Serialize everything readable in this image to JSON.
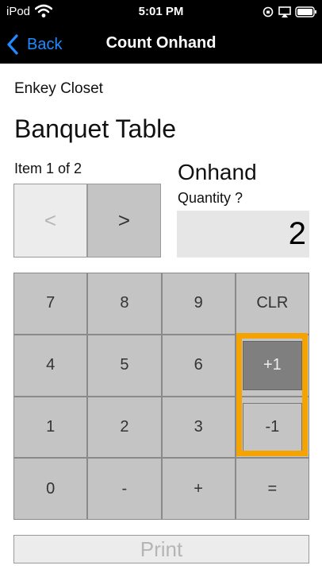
{
  "status_bar": {
    "carrier": "iPod",
    "time": "5:01 PM",
    "icons": [
      "wifi-icon",
      "orientation-lock-icon",
      "airplay-icon",
      "battery-icon"
    ]
  },
  "nav_bar": {
    "back_label": "Back",
    "title": "Count Onhand",
    "accent_color": "#1f8bff"
  },
  "item": {
    "location": "Enkey Closet",
    "name": "Banquet Table",
    "counter": "Item 1 of 2"
  },
  "quantity": {
    "heading": "Onhand",
    "label": "Quantity ?",
    "value": "2"
  },
  "item_nav": {
    "prev_label": "<",
    "next_label": ">"
  },
  "keypad": {
    "rows": [
      [
        "7",
        "8",
        "9",
        "CLR"
      ],
      [
        "4",
        "5",
        "6",
        "+1"
      ],
      [
        "1",
        "2",
        "3",
        "-1"
      ],
      [
        "0",
        "-",
        "+",
        "="
      ]
    ],
    "highlight_color": "#f5a300"
  },
  "print_label": "Print"
}
